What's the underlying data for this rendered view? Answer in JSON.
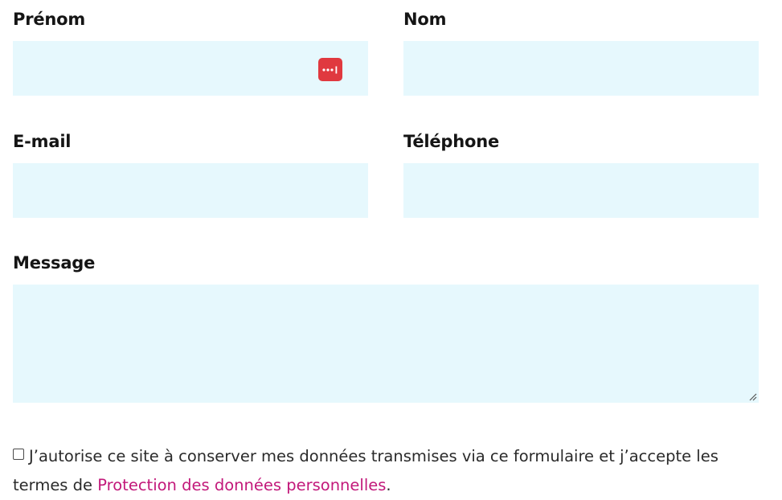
{
  "form": {
    "first_name": {
      "label": "Prénom",
      "value": ""
    },
    "last_name": {
      "label": "Nom",
      "value": ""
    },
    "email": {
      "label": "E-mail",
      "value": ""
    },
    "phone": {
      "label": "Téléphone",
      "value": ""
    },
    "message": {
      "label": "Message",
      "value": ""
    },
    "consent": {
      "text_before": "J’autorise ce site à conserver mes données transmises via ce formulaire et j’accepte les termes de ",
      "link_text": "Protection des données personnelles",
      "text_after": ".",
      "checked": false
    },
    "password_manager_icon": "password-manager-icon"
  },
  "colors": {
    "field_background": "#e6f8fd",
    "link": "#c2187a",
    "icon_red": "#e0393f"
  }
}
